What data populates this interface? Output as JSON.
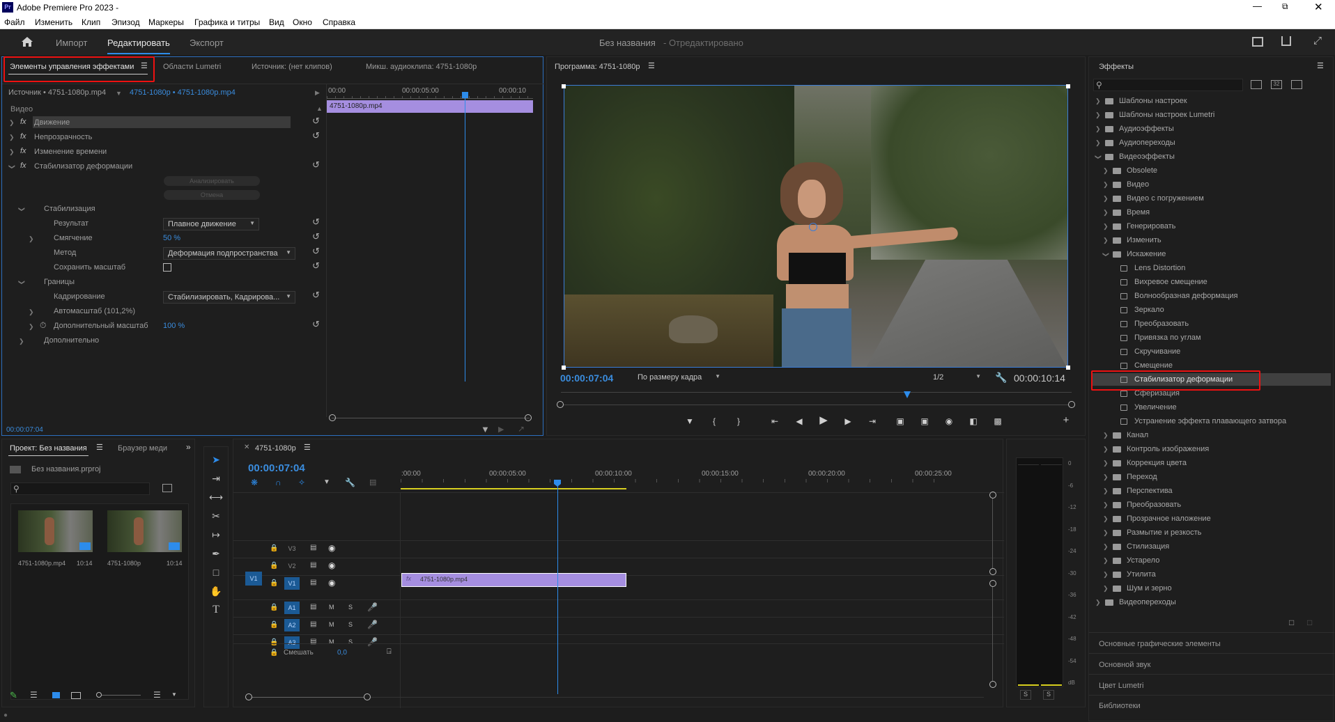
{
  "window": {
    "title": "Adobe Premiere Pro 2023 -",
    "app_icon": "Pr"
  },
  "menu": [
    "Файл",
    "Изменить",
    "Клип",
    "Эпизод",
    "Маркеры",
    "Графика и титры",
    "Вид",
    "Окно",
    "Справка"
  ],
  "header": {
    "tabs": [
      "Импорт",
      "Редактировать",
      "Экспорт"
    ],
    "active": "Редактировать",
    "project_title": "Без названия",
    "project_status": "- Отредактировано"
  },
  "effect_controls": {
    "tabs": [
      "Элементы управления эффектами",
      "Области Lumetri",
      "Источник: (нет клипов)",
      "Микш. аудиоклипа: 4751-1080p"
    ],
    "source_label": "Источник • 4751-1080p.mp4",
    "sequence_label": "4751-1080p • 4751-1080p.mp4",
    "ruler": [
      "00:00",
      "00:00:05:00",
      "00:00:10"
    ],
    "clip_name": "4751-1080p.mp4",
    "section_video": "Видео",
    "effects": [
      "Движение",
      "Непрозрачность",
      "Изменение времени",
      "Стабилизатор деформации"
    ],
    "analyze_btn": "Анализировать",
    "cancel_btn": "Отмена",
    "stabilization": "Стабилизация",
    "result_label": "Результат",
    "result_value": "Плавное движение",
    "smoothing_label": "Смягчение",
    "smoothing_value": "50 %",
    "method_label": "Метод",
    "method_value": "Деформация подпространства",
    "keep_scale_label": "Сохранить масштаб",
    "borders": "Границы",
    "crop_label": "Кадрирование",
    "crop_value": "Стабилизировать, Кадрирова...",
    "autoscale_label": "Автомасштаб (101,2%)",
    "extra_scale_label": "Дополнительный масштаб",
    "extra_scale_value": "100 %",
    "advanced": "Дополнительно",
    "timecode": "00:00:07:04"
  },
  "program": {
    "title": "Программа: 4751-1080p",
    "timecode": "00:00:07:04",
    "fit": "По размеру кадра",
    "quality": "1/2",
    "duration": "00:00:10:14"
  },
  "effects_panel": {
    "title": "Эффекты",
    "tree": [
      {
        "label": "Шаблоны настроек",
        "level": 0,
        "type": "folder"
      },
      {
        "label": "Шаблоны настроек Lumetri",
        "level": 0,
        "type": "folder"
      },
      {
        "label": "Аудиоэффекты",
        "level": 0,
        "type": "folder"
      },
      {
        "label": "Аудиопереходы",
        "level": 0,
        "type": "folder"
      },
      {
        "label": "Видеоэффекты",
        "level": 0,
        "type": "folder",
        "open": true
      },
      {
        "label": "Obsolete",
        "level": 1,
        "type": "folder"
      },
      {
        "label": "Видео",
        "level": 1,
        "type": "folder"
      },
      {
        "label": "Видео с погружением",
        "level": 1,
        "type": "folder"
      },
      {
        "label": "Время",
        "level": 1,
        "type": "folder"
      },
      {
        "label": "Генерировать",
        "level": 1,
        "type": "folder"
      },
      {
        "label": "Изменить",
        "level": 1,
        "type": "folder"
      },
      {
        "label": "Искажение",
        "level": 1,
        "type": "folder",
        "open": true
      },
      {
        "label": "Lens Distortion",
        "level": 2,
        "type": "fx"
      },
      {
        "label": "Вихревое смещение",
        "level": 2,
        "type": "fx"
      },
      {
        "label": "Волнообразная деформация",
        "level": 2,
        "type": "fx"
      },
      {
        "label": "Зеркало",
        "level": 2,
        "type": "fx"
      },
      {
        "label": "Преобразовать",
        "level": 2,
        "type": "fx"
      },
      {
        "label": "Привязка по углам",
        "level": 2,
        "type": "fx"
      },
      {
        "label": "Скручивание",
        "level": 2,
        "type": "fx"
      },
      {
        "label": "Смещение",
        "level": 2,
        "type": "fx"
      },
      {
        "label": "Стабилизатор деформации",
        "level": 2,
        "type": "fx",
        "selected": true
      },
      {
        "label": "Сферизация",
        "level": 2,
        "type": "fx"
      },
      {
        "label": "Увеличение",
        "level": 2,
        "type": "fx"
      },
      {
        "label": "Устранение эффекта плавающего затвора",
        "level": 2,
        "type": "fx"
      },
      {
        "label": "Канал",
        "level": 1,
        "type": "folder"
      },
      {
        "label": "Контроль изображения",
        "level": 1,
        "type": "folder"
      },
      {
        "label": "Коррекция цвета",
        "level": 1,
        "type": "folder"
      },
      {
        "label": "Переход",
        "level": 1,
        "type": "folder"
      },
      {
        "label": "Перспектива",
        "level": 1,
        "type": "folder"
      },
      {
        "label": "Преобразовать",
        "level": 1,
        "type": "folder"
      },
      {
        "label": "Прозрачное наложение",
        "level": 1,
        "type": "folder"
      },
      {
        "label": "Размытие и резкость",
        "level": 1,
        "type": "folder"
      },
      {
        "label": "Стилизация",
        "level": 1,
        "type": "folder"
      },
      {
        "label": "Устарело",
        "level": 1,
        "type": "folder"
      },
      {
        "label": "Утилита",
        "level": 1,
        "type": "folder"
      },
      {
        "label": "Шум и зерно",
        "level": 1,
        "type": "folder"
      },
      {
        "label": "Видеопереходы",
        "level": 0,
        "type": "folder"
      }
    ],
    "collapsed_panels": [
      "Основные графические элементы",
      "Основной звук",
      "Цвет Lumetri",
      "Библиотеки"
    ]
  },
  "project": {
    "tabs": [
      "Проект: Без названия",
      "Браузер меди"
    ],
    "file": "Без названия.prproj",
    "items": [
      {
        "name": "4751-1080p.mp4",
        "duration": "10:14"
      },
      {
        "name": "4751-1080p",
        "duration": "10:14"
      }
    ]
  },
  "timeline": {
    "tab": "4751-1080p",
    "timecode": "00:00:07:04",
    "ruler": [
      ":00:00",
      "00:00:05:00",
      "00:00:10:00",
      "00:00:15:00",
      "00:00:20:00",
      "00:00:25:00"
    ],
    "video_tracks": [
      "V3",
      "V2",
      "V1"
    ],
    "audio_tracks": [
      "A1",
      "A2",
      "A3"
    ],
    "source_patch": "V1",
    "mix_label": "Смешать",
    "mix_value": "0,0",
    "clip_name": "4751-1080p.mp4",
    "track_m": "M",
    "track_s": "S"
  },
  "meter": {
    "scale": [
      "0",
      "-6",
      "-12",
      "-18",
      "-24",
      "-30",
      "-36",
      "-42",
      "-48",
      "-54",
      "dB"
    ],
    "solo": [
      "S",
      "S"
    ]
  },
  "colors": {
    "accent": "#2d8ceb",
    "clip": "#a58ee0",
    "highlight_box": "#e11111"
  }
}
